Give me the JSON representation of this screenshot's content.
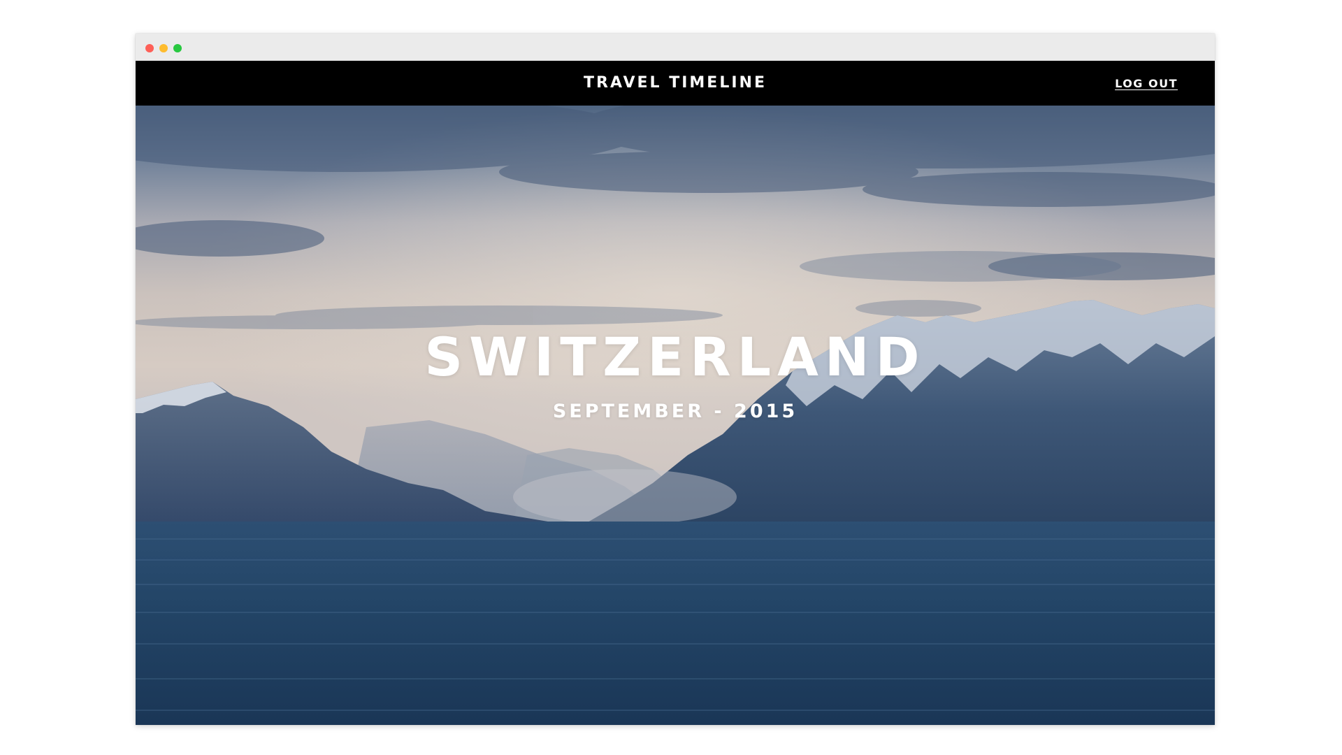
{
  "window": {
    "controls": [
      "close",
      "minimize",
      "maximize"
    ]
  },
  "navbar": {
    "title": "TRAVEL TIMELINE",
    "logout_label": "LOG OUT"
  },
  "hero": {
    "title": "SWITZERLAND",
    "subtitle": "SEPTEMBER - 2015",
    "image": "mountain-lake-landscape"
  },
  "colors": {
    "navbar_bg": "#000000",
    "text": "#ffffff",
    "chrome_bg": "#ebebeb",
    "close": "#fe5f57",
    "minimize": "#febc2e",
    "maximize": "#28c840"
  }
}
